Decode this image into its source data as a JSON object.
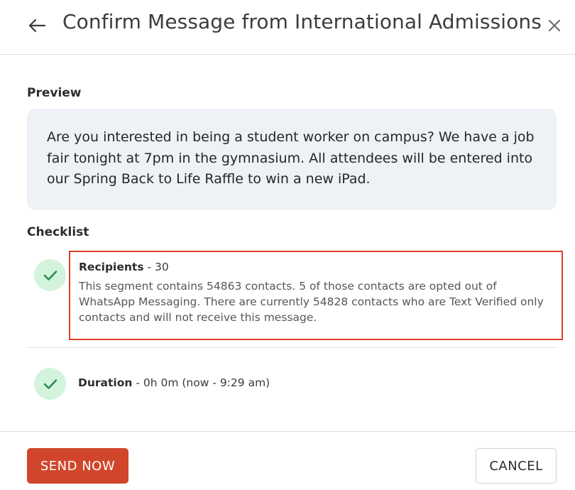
{
  "header": {
    "title": "Confirm Message from International Admissions",
    "back_icon": "arrow-left-icon",
    "close_icon": "close-icon"
  },
  "preview": {
    "label": "Preview",
    "message": "Are you interested in being a student worker on campus? We have a job fair tonight at 7pm in the gymnasium. All attendees will be entered into our Spring Back to Life Raffle to win a new iPad."
  },
  "checklist": {
    "label": "Checklist",
    "items": [
      {
        "title": "Recipients",
        "value": " - 30",
        "description": "This segment contains 54863 contacts. 5 of those contacts are opted out of WhatsApp Messaging. There are currently 54828 contacts who are Text Verified only contacts and will not receive this message.",
        "status": "complete",
        "icon": "check-icon"
      },
      {
        "title": "Duration",
        "value": " - 0h 0m (now - 9:29 am)",
        "status": "complete",
        "icon": "check-icon"
      }
    ]
  },
  "footer": {
    "send_label": "SEND NOW",
    "cancel_label": "CANCEL"
  },
  "colors": {
    "accent": "#d1462b",
    "highlight_border": "#d9402b",
    "check_bg": "#d4f3dc",
    "check_fg": "#2e8b4e",
    "preview_bg": "#eef1f5"
  }
}
